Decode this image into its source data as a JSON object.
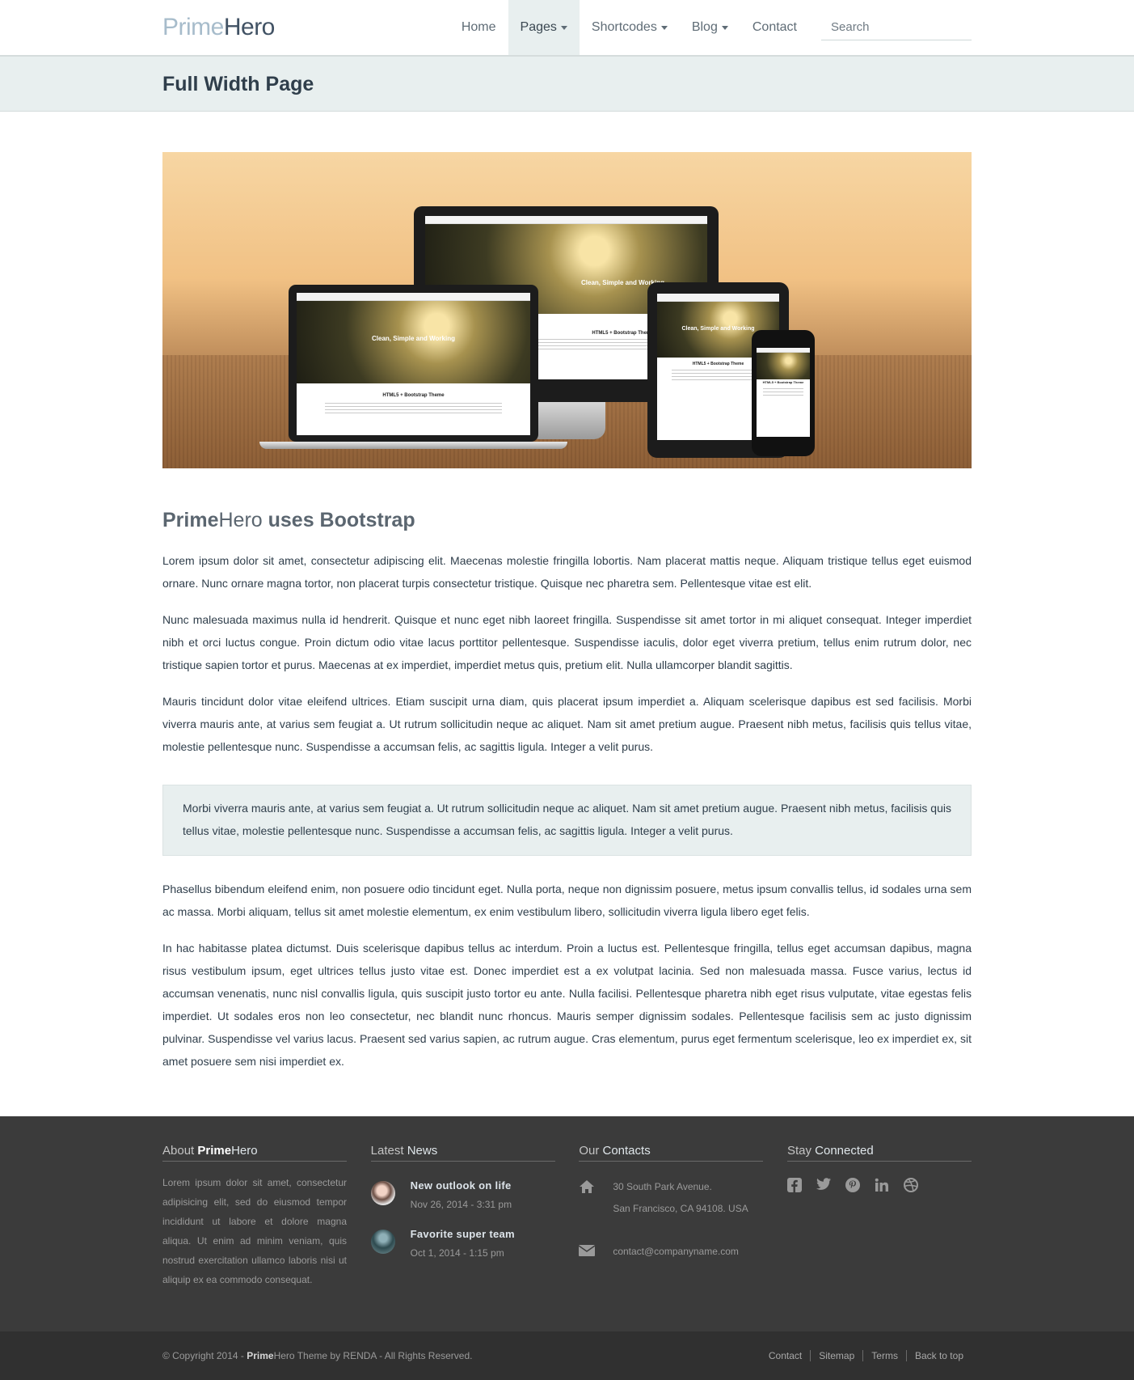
{
  "logo": {
    "prime": "Prime",
    "hero": "Hero"
  },
  "nav": {
    "items": [
      {
        "label": "Home",
        "dropdown": false,
        "active": false
      },
      {
        "label": "Pages",
        "dropdown": true,
        "active": true
      },
      {
        "label": "Shortcodes",
        "dropdown": true,
        "active": false
      },
      {
        "label": "Blog",
        "dropdown": true,
        "active": false
      },
      {
        "label": "Contact",
        "dropdown": false,
        "active": false
      }
    ],
    "search_placeholder": "Search"
  },
  "page_title": "Full Width Page",
  "hero": {
    "laptop_caption": "Clean, Simple and Working",
    "laptop_subtitle": "HTML5 + Bootstrap Theme",
    "desktop_caption": "Clean, Simple and Working",
    "desktop_subtitle": "HTML5 + Bootstrap Theme",
    "tablet_caption": "Clean, Simple and Working",
    "tablet_subtitle": "HTML5 + Bootstrap Theme",
    "phone_subtitle": "HTML5 + Bootstrap Theme"
  },
  "content": {
    "heading_prime": "Prime",
    "heading_hero": "Hero",
    "heading_rest": " uses Bootstrap",
    "p1": "Lorem ipsum dolor sit amet, consectetur adipiscing elit. Maecenas molestie fringilla lobortis. Nam placerat mattis neque. Aliquam tristique tellus eget euismod ornare. Nunc ornare magna tortor, non placerat turpis consectetur tristique. Quisque nec pharetra sem. Pellentesque vitae est elit.",
    "p2": "Nunc malesuada maximus nulla id hendrerit. Quisque et nunc eget nibh laoreet fringilla. Suspendisse sit amet tortor in mi aliquet consequat. Integer imperdiet nibh et orci luctus congue. Proin dictum odio vitae lacus porttitor pellentesque. Suspendisse iaculis, dolor eget viverra pretium, tellus enim rutrum dolor, nec tristique sapien tortor et purus. Maecenas at ex imperdiet, imperdiet metus quis, pretium elit. Nulla ullamcorper blandit sagittis.",
    "p3": "Mauris tincidunt dolor vitae eleifend ultrices. Etiam suscipit urna diam, quis placerat ipsum imperdiet a. Aliquam scelerisque dapibus est sed facilisis. Morbi viverra mauris ante, at varius sem feugiat a. Ut rutrum sollicitudin neque ac aliquet. Nam sit amet pretium augue. Praesent nibh metus, facilisis quis tellus vitae, molestie pellentesque nunc. Suspendisse a accumsan felis, ac sagittis ligula. Integer a velit purus.",
    "quote": "Morbi viverra mauris ante, at varius sem feugiat a. Ut rutrum sollicitudin neque ac aliquet. Nam sit amet pretium augue. Praesent nibh metus, facilisis quis tellus vitae, molestie pellentesque nunc. Suspendisse a accumsan felis, ac sagittis ligula. Integer a velit purus.",
    "p4": "Phasellus bibendum eleifend enim, non posuere odio tincidunt eget. Nulla porta, neque non dignissim posuere, metus ipsum convallis tellus, id sodales urna sem ac massa. Morbi aliquam, tellus sit amet molestie elementum, ex enim vestibulum libero, sollicitudin viverra ligula libero eget felis.",
    "p5": "In hac habitasse platea dictumst. Duis scelerisque dapibus tellus ac interdum. Proin a luctus est. Pellentesque fringilla, tellus eget accumsan dapibus, magna risus vestibulum ipsum, eget ultrices tellus justo vitae est. Donec imperdiet est a ex volutpat lacinia. Sed non malesuada massa. Fusce varius, lectus id accumsan venenatis, nunc nisl convallis ligula, quis suscipit justo tortor eu ante. Nulla facilisi. Pellentesque pharetra nibh eget risus vulputate, vitae egestas felis imperdiet. Ut sodales eros non leo consectetur, nec blandit nunc rhoncus. Mauris semper dignissim sodales. Pellentesque facilisis sem ac justo dignissim pulvinar. Suspendisse vel varius lacus. Praesent sed varius sapien, ac rutrum augue. Cras elementum, purus eget fermentum scelerisque, leo ex imperdiet ex, sit amet posuere sem nisi imperdiet ex."
  },
  "footer": {
    "about": {
      "title_a": "About ",
      "title_prime": "Prime",
      "title_hero": "Hero",
      "text": "Lorem ipsum dolor sit amet, consectetur adipisicing elit, sed do eiusmod tempor incididunt ut labore et dolore magna aliqua. Ut enim ad minim veniam, quis nostrud exercitation ullamco laboris nisi ut aliquip ex ea commodo consequat."
    },
    "news": {
      "title_a": "Latest ",
      "title_b": "News",
      "items": [
        {
          "title": "New outlook on life",
          "date": "Nov 26, 2014 - 3:31 pm"
        },
        {
          "title": "Favorite super team",
          "date": "Oct 1, 2014 - 1:15 pm"
        }
      ]
    },
    "contacts": {
      "title_a": "Our ",
      "title_b": "Contacts",
      "address_line1": "30 South Park Avenue.",
      "address_line2": "San Francisco, CA 94108. USA",
      "email": "contact@companyname.com"
    },
    "social": {
      "title_a": "Stay ",
      "title_b": "Connected",
      "icons": [
        "facebook-icon",
        "twitter-icon",
        "pinterest-icon",
        "linkedin-icon",
        "dribbble-icon"
      ]
    }
  },
  "bottom": {
    "copyright_a": "© Copyright 2014 - ",
    "copyright_prime": "Prime",
    "copyright_b": "Hero Theme by RENDA - All Rights Reserved.",
    "links": [
      "Contact",
      "Sitemap",
      "Terms",
      "Back to top"
    ]
  }
}
